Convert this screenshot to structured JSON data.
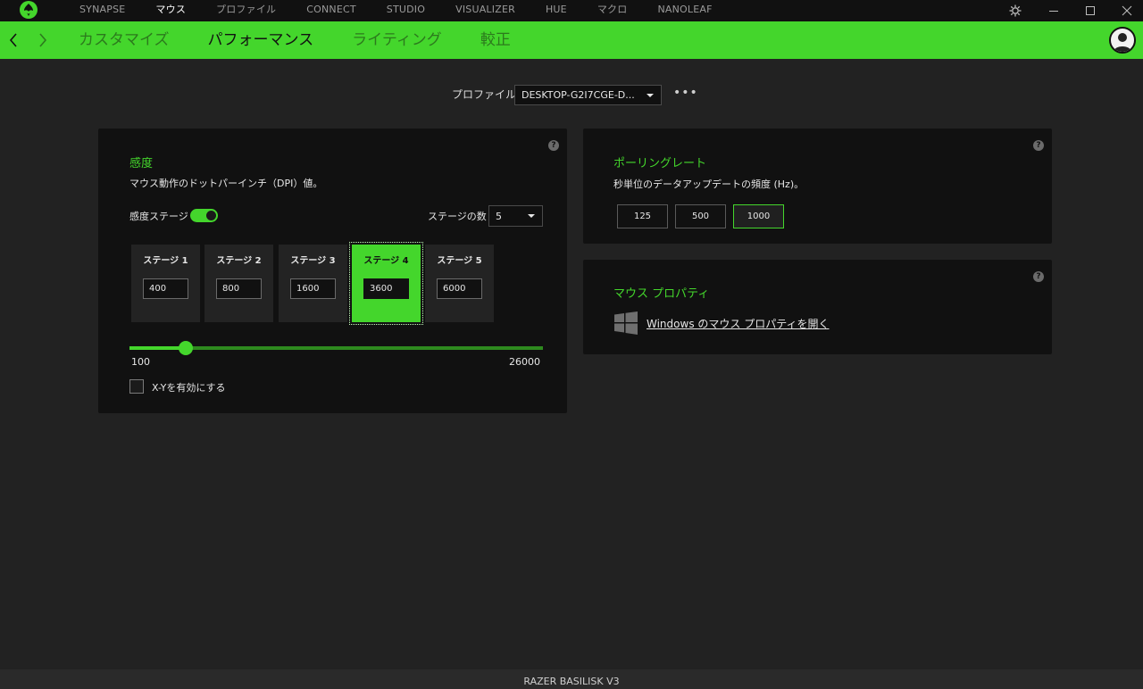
{
  "topnav": {
    "items": [
      "SYNAPSE",
      "マウス",
      "プロファイル",
      "CONNECT",
      "STUDIO",
      "VISUALIZER",
      "HUE",
      "マクロ",
      "NANOLEAF"
    ],
    "active_index": 1
  },
  "subnav": {
    "tabs": [
      "カスタマイズ",
      "パフォーマンス",
      "ライティング",
      "較正"
    ],
    "active_index": 1
  },
  "profile": {
    "label": "プロファイル",
    "selected": "DESKTOP-G2I7CGE-D..."
  },
  "sensitivity": {
    "title": "感度",
    "description": "マウス動作のドットパーインチ（DPI）値。",
    "stages_toggle_label": "感度ステージ",
    "stages_toggle_on": true,
    "stage_count_label": "ステージの数",
    "stage_count_value": "5",
    "stages": [
      {
        "label": "ステージ 1",
        "value": "400"
      },
      {
        "label": "ステージ 2",
        "value": "800"
      },
      {
        "label": "ステージ 3",
        "value": "1600"
      },
      {
        "label": "ステージ 4",
        "value": "3600"
      },
      {
        "label": "ステージ 5",
        "value": "6000"
      }
    ],
    "active_stage_index": 3,
    "slider_min_label": "100",
    "slider_max_label": "26000",
    "slider_min": 100,
    "slider_max": 26000,
    "slider_value": 3600,
    "xy_label": "X-Yを有効にする",
    "xy_enabled": false
  },
  "polling": {
    "title": "ポーリングレート",
    "description": "秒単位のデータアップデートの頻度 (Hz)。",
    "options": [
      "125",
      "500",
      "1000"
    ],
    "selected": "1000"
  },
  "mouse_props": {
    "title": "マウス プロパティ",
    "link_text": "Windows のマウス プロパティを開く"
  },
  "help_glyph": "?",
  "more_glyph": "•••",
  "status_bar": "RAZER BASILISK V3",
  "colors": {
    "accent": "#44d62c",
    "panel": "#111111",
    "background": "#222222"
  }
}
